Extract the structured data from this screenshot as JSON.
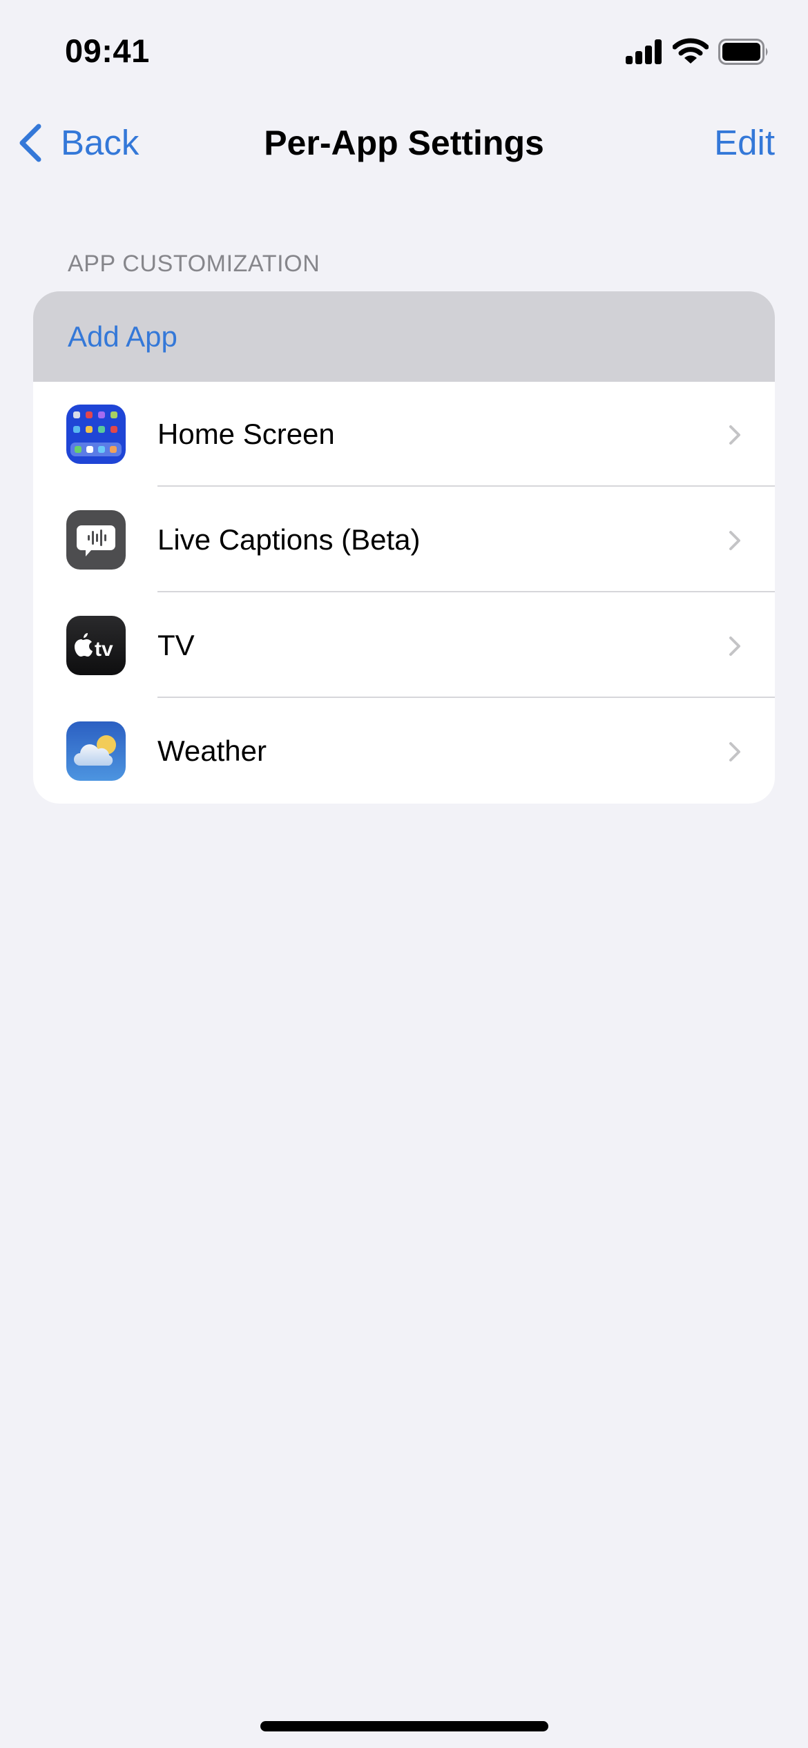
{
  "status_bar": {
    "time": "09:41",
    "signal_icon": "cellular-signal-icon",
    "wifi_icon": "wifi-icon",
    "battery_icon": "battery-full-icon",
    "battery_level": 1.0
  },
  "nav": {
    "back_label": "Back",
    "title": "Per-App Settings",
    "edit_label": "Edit"
  },
  "section": {
    "header": "APP CUSTOMIZATION",
    "add_app_label": "Add App",
    "apps": [
      {
        "label": "Home Screen",
        "icon": "home-screen-icon"
      },
      {
        "label": "Live Captions (Beta)",
        "icon": "live-captions-icon"
      },
      {
        "label": "TV",
        "icon": "apple-tv-icon"
      },
      {
        "label": "Weather",
        "icon": "weather-icon"
      }
    ]
  },
  "colors": {
    "accent": "#3478d8",
    "background": "#f2f2f7",
    "add_row_highlight": "#d1d1d6",
    "secondary_text": "#86868b",
    "chevron": "#c4c4c6"
  }
}
